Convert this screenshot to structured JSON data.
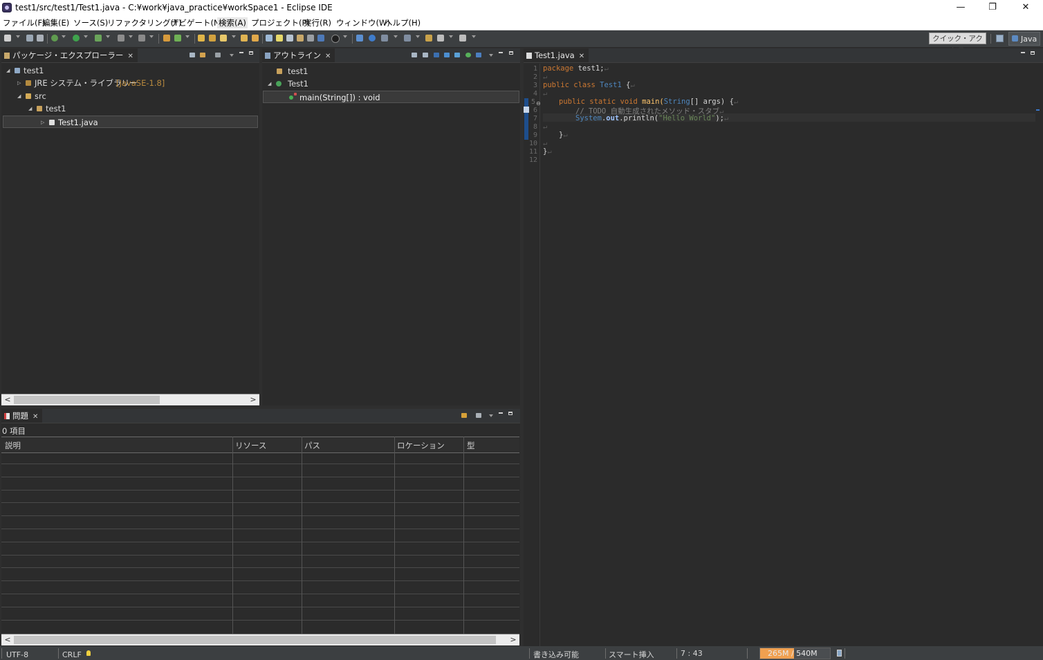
{
  "window": {
    "title": "test1/src/test1/Test1.java - C:¥work¥java_practice¥workSpace1 - Eclipse IDE",
    "minimize": "—",
    "restore": "❐",
    "close": "✕"
  },
  "menu": [
    "ファイル(F)",
    "編集(E)",
    "ソース(S)",
    "リファクタリング(T)",
    "ナビゲート(N)",
    "検索(A)",
    "プロジェクト(P)",
    "実行(R)",
    "ウィンドウ(W)",
    "ヘルプ(H)"
  ],
  "toolbar": {
    "quick_access": "クイック・アクセス",
    "perspective": "Java"
  },
  "package_explorer": {
    "tab": "パッケージ・エクスプローラー",
    "close": "✕",
    "tree": {
      "project": "test1",
      "jre": "JRE システム・ライブラリー",
      "jre_version": "[JavaSE-1.8]",
      "src": "src",
      "package": "test1",
      "file": "Test1.java"
    },
    "h_scroll_thumb": 0.62
  },
  "outline": {
    "tab": "アウトライン",
    "close": "✕",
    "items": [
      "test1",
      "Test1",
      "main(String[]) : void"
    ]
  },
  "editor": {
    "tab": "Test1.java",
    "close": "✕",
    "line_numbers": [
      "1",
      "2",
      "3",
      "4",
      "5",
      "6",
      "7",
      "8",
      "9",
      "10",
      "11",
      "12"
    ],
    "code": {
      "l1_kw": "package",
      "l1_rest": " test1;",
      "l3_kw": "public class",
      "l3_name": " Test1",
      "l3_rest": " {",
      "l5_kw": "public static void",
      "l5_name": " main(",
      "l5_type": "String",
      "l5_rest": "[] args) {",
      "l6_comment": "// TODO 自動生成されたメソッド・スタブ",
      "l7_type": "System",
      "l7_dot": ".",
      "l7_field": "out",
      "l7_call": ".println(",
      "l7_str": "\"Hello World\"",
      "l7_end": ");",
      "l9_brace": "}",
      "l11_brace": "}"
    },
    "eol_mark": "↵"
  },
  "problems": {
    "tab": "問題",
    "close": "✕",
    "count": "0 項目",
    "columns": [
      "説明",
      "リソース",
      "パス",
      "ロケーション",
      "型"
    ]
  },
  "statusbar": {
    "encoding": "UTF-8",
    "line_delimiter": "CRLF",
    "writable": "書き込み可能",
    "insert_mode": "スマート挿入",
    "position": "7 : 43",
    "heap": "265M / 540M",
    "heap_used_fraction": 0.49
  }
}
